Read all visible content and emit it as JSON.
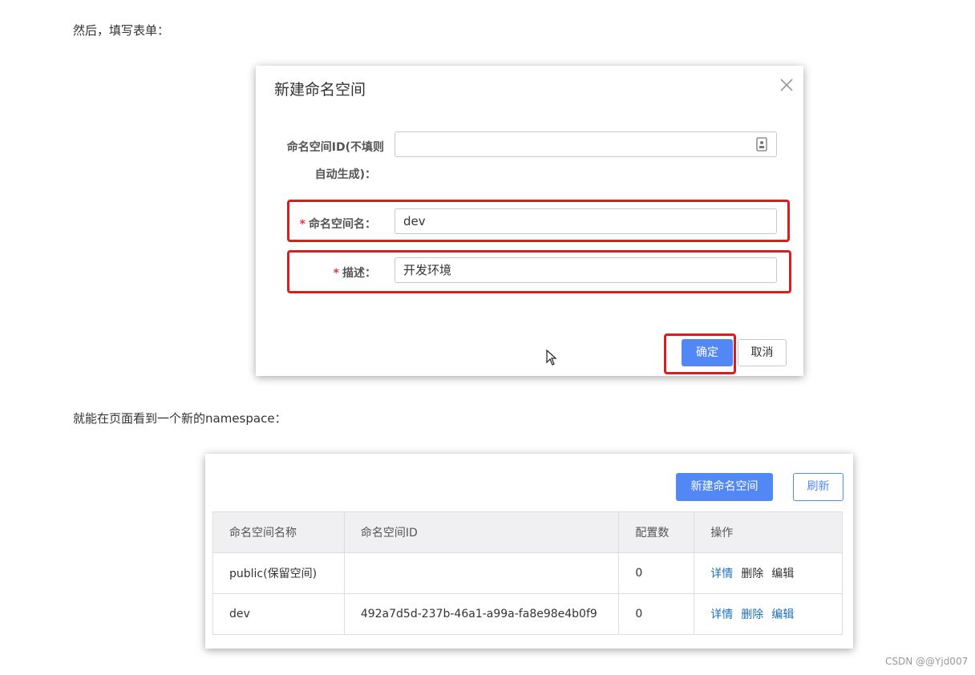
{
  "intro_text": "然后，填写表单：",
  "dialog": {
    "title": "新建命名空间",
    "id_label_line1": "命名空间ID(不填则",
    "id_label_line2": "自动生成)：",
    "id_value": "",
    "name_label": "命名空间名：",
    "name_value": "dev",
    "desc_label": "描述：",
    "desc_value": "开发环境",
    "required_mark": "*",
    "ok_label": "确定",
    "cancel_label": "取消"
  },
  "middle_text": "就能在页面看到一个新的namespace：",
  "panel": {
    "new_button": "新建命名空间",
    "refresh_button": "刷新",
    "columns": [
      "命名空间名称",
      "命名空间ID",
      "配置数",
      "操作"
    ],
    "rows": [
      {
        "name": "public(保留空间)",
        "id": "",
        "count": "0",
        "ops": [
          "详情",
          "删除",
          "编辑"
        ]
      },
      {
        "name": "dev",
        "id": "492a7d5d-237b-46a1-a99a-fa8e98e4b0f9",
        "count": "0",
        "ops": [
          "详情",
          "删除",
          "编辑"
        ]
      }
    ]
  },
  "watermark": "CSDN @@Yjd007",
  "colors": {
    "primary": "#5288f6",
    "highlight": "#d81e1e",
    "link": "#1b6fc0",
    "required": "#e4393c"
  }
}
